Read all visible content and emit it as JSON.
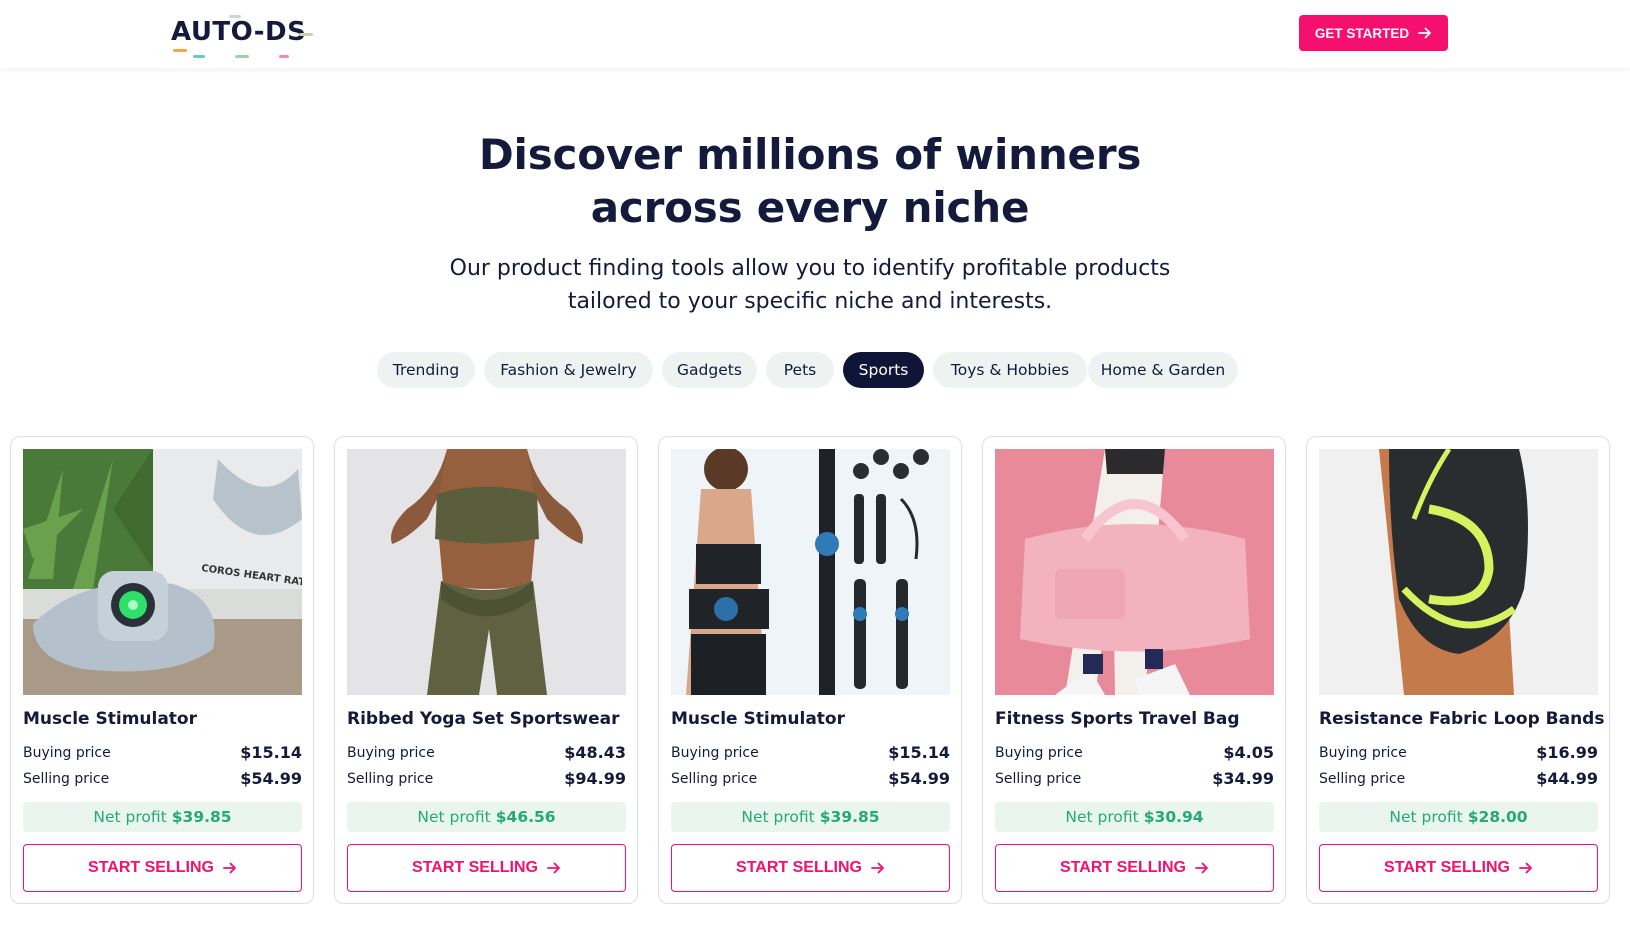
{
  "brand": {
    "logo_text": "AUTO-DS",
    "colors": {
      "accent": "#f50f6e",
      "navy": "#0f1536",
      "profit_green": "#26a97a",
      "profit_bg": "#eaf5f0",
      "chip_bg": "#eef3f1"
    }
  },
  "header": {
    "cta_label": "GET STARTED",
    "cta_icon": "arrow-right-icon"
  },
  "hero": {
    "title_line1": "Discover millions of winners",
    "title_line2": "across every niche",
    "subtitle_line1": "Our product finding tools allow you to identify profitable products",
    "subtitle_line2": "tailored to your specific niche and interests."
  },
  "tabs": [
    {
      "label": "Trending",
      "active": false
    },
    {
      "label": "Fashion & Jewelry",
      "active": false
    },
    {
      "label": "Gadgets",
      "active": false
    },
    {
      "label": "Pets",
      "active": false
    },
    {
      "label": "Sports",
      "active": true
    },
    {
      "label": "Toys & Hobbies",
      "active": false
    },
    {
      "label": "Home & Garden",
      "active": false
    }
  ],
  "labels": {
    "buying_price": "Buying price",
    "selling_price": "Selling price",
    "net_profit": "Net profit",
    "start_selling": "START SELLING"
  },
  "products": [
    {
      "title": "Muscle Stimulator",
      "buying_price": "$15.14",
      "selling_price": "$54.99",
      "net_profit": "$39.85",
      "image_text": "COROS HEART RATE MONIT"
    },
    {
      "title": "Ribbed Yoga Set Sportswear",
      "buying_price": "$48.43",
      "selling_price": "$94.99",
      "net_profit": "$46.56"
    },
    {
      "title": "Muscle Stimulator",
      "buying_price": "$15.14",
      "selling_price": "$54.99",
      "net_profit": "$39.85"
    },
    {
      "title": "Fitness Sports Travel Bag",
      "buying_price": "$4.05",
      "selling_price": "$34.99",
      "net_profit": "$30.94"
    },
    {
      "title": "Resistance Fabric Loop Bands",
      "buying_price": "$16.99",
      "selling_price": "$44.99",
      "net_profit": "$28.00"
    }
  ]
}
